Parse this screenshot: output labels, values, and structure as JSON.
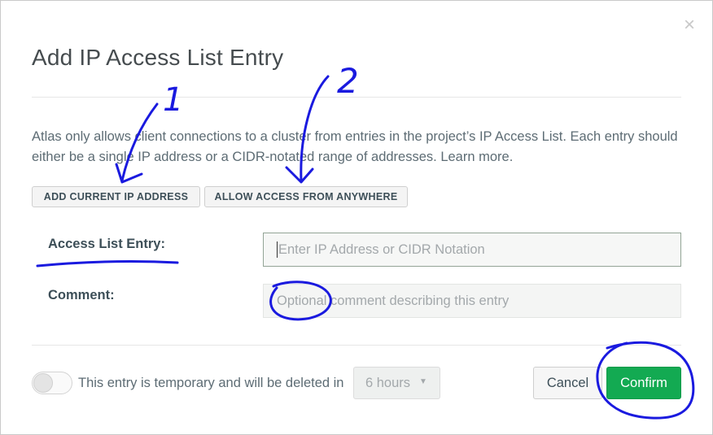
{
  "dialog": {
    "title": "Add IP Access List Entry",
    "close_glyph": "×",
    "description": "Atlas only allows client connections to a cluster from entries in the project’s IP Access List. Each entry should either be a single IP address or a CIDR-notated range of addresses.",
    "learn_more": "Learn more."
  },
  "actions": {
    "add_current_ip": "ADD CURRENT IP ADDRESS",
    "allow_anywhere": "ALLOW ACCESS FROM ANYWHERE"
  },
  "form": {
    "entry_label": "Access List Entry:",
    "entry_placeholder": "Enter IP Address or CIDR Notation",
    "comment_label": "Comment:",
    "comment_placeholder": "Optional comment describing this entry"
  },
  "footer": {
    "temporary_text": "This entry is temporary and will be deleted in",
    "temporary_toggle_on": false,
    "duration_selected": "6 hours",
    "cancel": "Cancel",
    "confirm": "Confirm"
  },
  "annotations": {
    "marker_1": "1",
    "marker_2": "2",
    "ink_color": "#1a1adf"
  },
  "colors": {
    "confirm_bg": "#13aa52",
    "text_dark": "#3d4f58",
    "text_muted": "#5d6c74"
  }
}
